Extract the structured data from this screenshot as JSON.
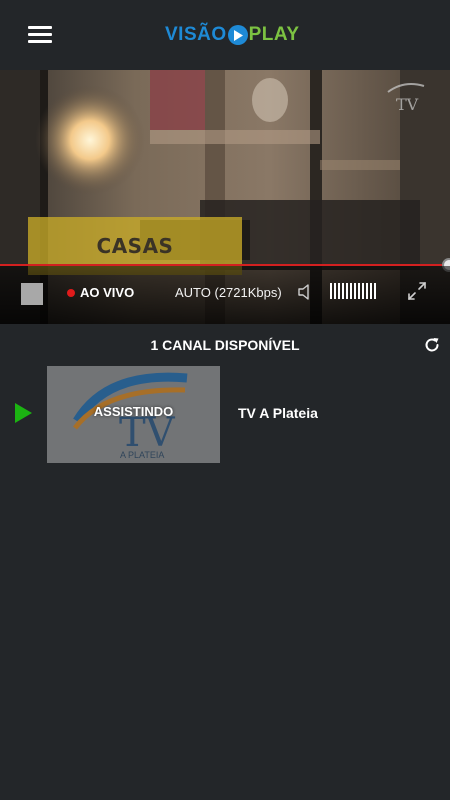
{
  "header": {
    "logo_part1": "VISÃO",
    "logo_part2": "PLAY",
    "menu_icon": "hamburger-icon"
  },
  "colors": {
    "background": "#232629",
    "brand_blue": "#1e8ad6",
    "brand_green": "#7cc242",
    "live_red": "#e01b1b",
    "progress_red": "#d32020",
    "playing_green": "#1bb312"
  },
  "player": {
    "caption": "CASAS",
    "live_label": "AO VIVO",
    "quality_label": "AUTO (2721Kbps)",
    "progress": 1.0,
    "volume_bars": 12,
    "icons": {
      "stop": "stop-icon",
      "volume": "volume-icon",
      "fullscreen": "fullscreen-icon"
    }
  },
  "channel_list": {
    "title": "1 CANAL DISPONÍVEL",
    "refresh_icon": "refresh-icon",
    "channels": [
      {
        "name": "TV A Plateia",
        "status": "ASSISTINDO",
        "logo_text": "TV",
        "logo_subtext": "A PLATEIA",
        "playing": true
      }
    ]
  }
}
